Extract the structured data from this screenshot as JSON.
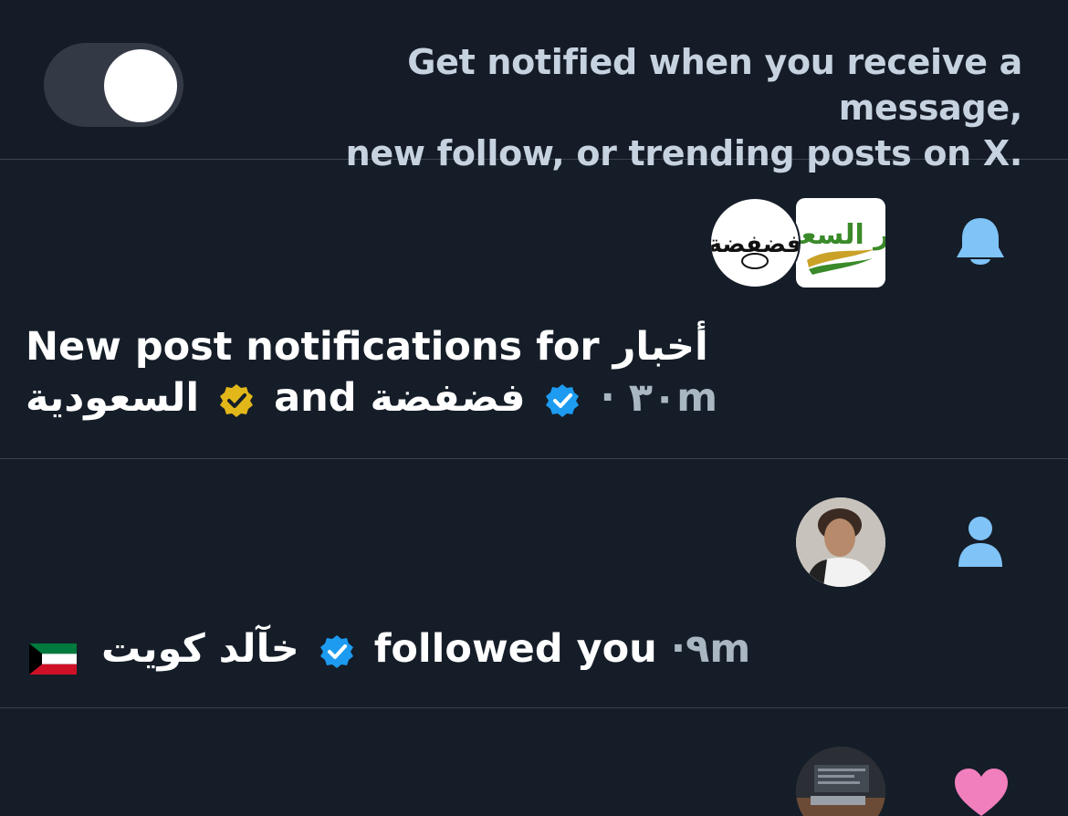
{
  "settings_banner": {
    "toggle": "off",
    "line1": "Get notified when you receive a message,",
    "line2": "new follow, or trending posts on X."
  },
  "notifications": [
    {
      "type": "bell-icon",
      "avatars": [
        "فضفضة",
        "أخبار السعودية"
      ],
      "line1": "New post notifications for أخبار",
      "line2_account1": "السعودية",
      "and": "and",
      "time_num": "٣٠",
      "account2": "فضفضة",
      "time_unit": "m"
    },
    {
      "type": "person-icon",
      "name": "خآلد كويت",
      "action": "followed you",
      "time_num": "٩m"
    },
    {
      "type": "heart-icon"
    }
  ],
  "colors": {
    "background": "#151d28",
    "verified_blue": "#1d9bf0",
    "verified_gold": "#e2b719",
    "bell_blue": "#7fc3f7",
    "heart_pink": "#f17fbd"
  }
}
